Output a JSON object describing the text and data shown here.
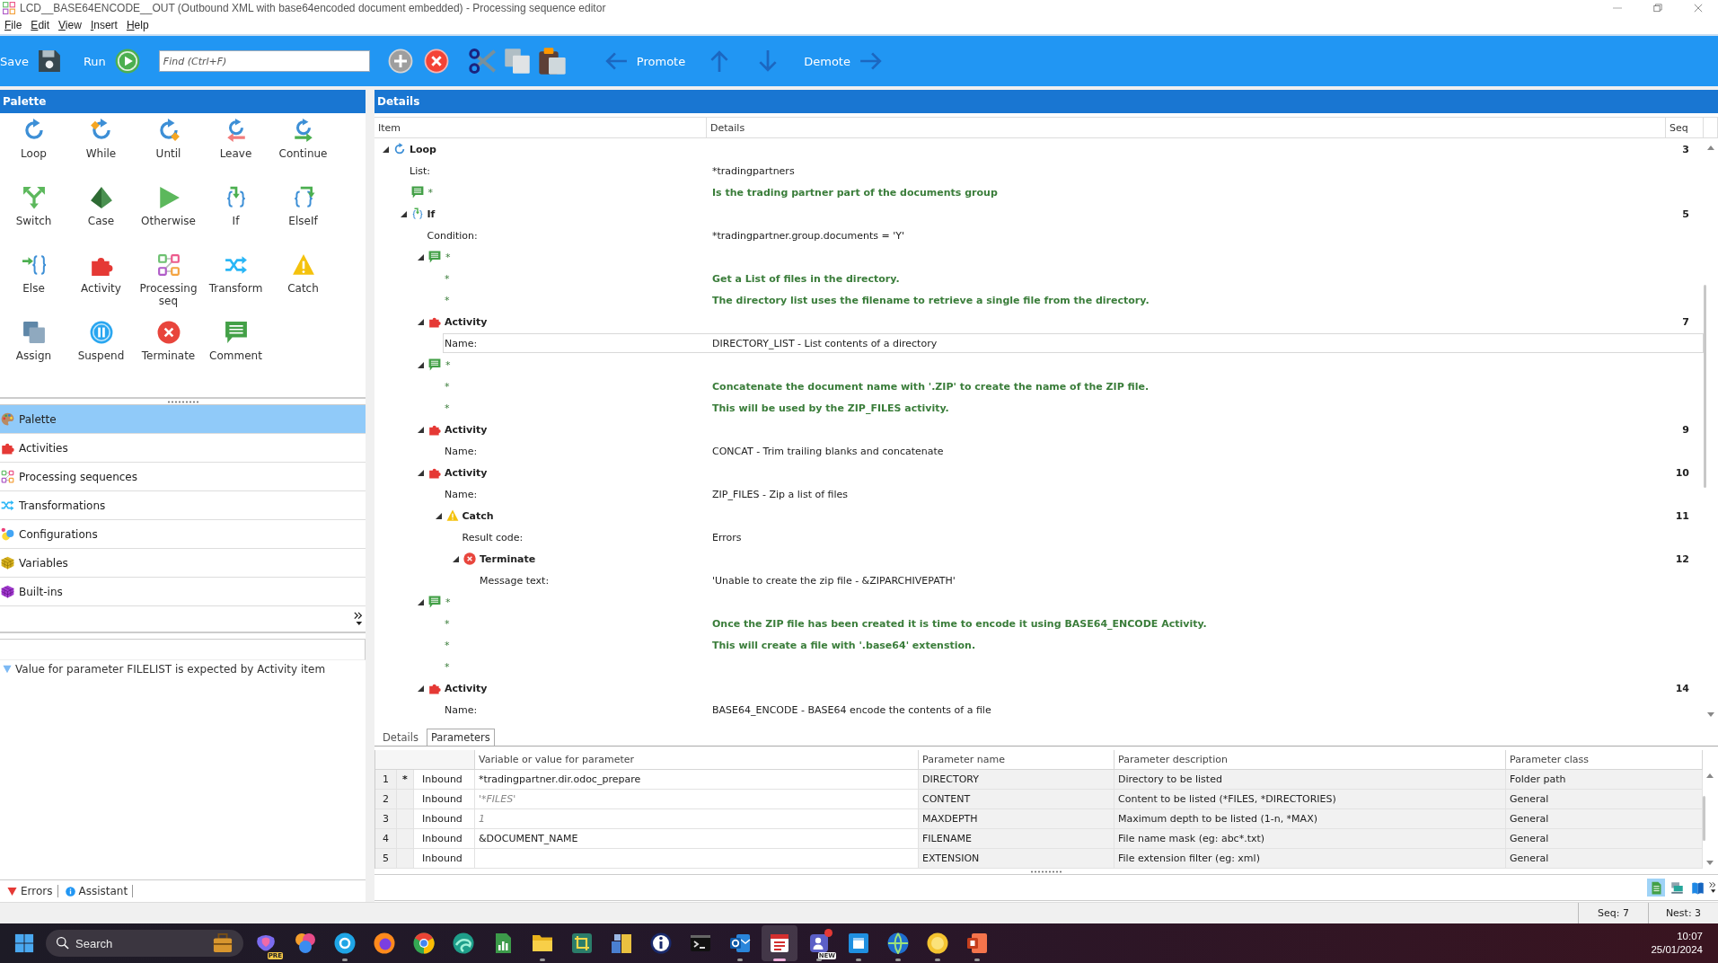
{
  "window": {
    "title": "LCD__BASE64ENCODE__OUT (Outbound XML with base64encoded document embedded) - Processing sequence editor"
  },
  "menu": [
    "File",
    "Edit",
    "View",
    "Insert",
    "Help"
  ],
  "toolbar": {
    "save": "Save",
    "run": "Run",
    "find": {
      "placeholder": "Find (Ctrl+F)"
    },
    "promote": "Promote",
    "demote": "Demote"
  },
  "palette": {
    "title": "Palette",
    "items": [
      {
        "label": "Loop",
        "kind": "loop"
      },
      {
        "label": "While",
        "kind": "while"
      },
      {
        "label": "Until",
        "kind": "until"
      },
      {
        "label": "Leave",
        "kind": "leave"
      },
      {
        "label": "Continue",
        "kind": "continue"
      },
      {
        "label": "Switch",
        "kind": "switch"
      },
      {
        "label": "Case",
        "kind": "case"
      },
      {
        "label": "Otherwise",
        "kind": "otherwise"
      },
      {
        "label": "If",
        "kind": "if"
      },
      {
        "label": "ElseIf",
        "kind": "elseif"
      },
      {
        "label": "Else",
        "kind": "else"
      },
      {
        "label": "Activity",
        "kind": "activity"
      },
      {
        "label": "Processing seq",
        "kind": "sequence"
      },
      {
        "label": "Transform",
        "kind": "transform"
      },
      {
        "label": "Catch",
        "kind": "catch"
      },
      {
        "label": "Assign",
        "kind": "assign"
      },
      {
        "label": "Suspend",
        "kind": "suspend"
      },
      {
        "label": "Terminate",
        "kind": "terminate"
      },
      {
        "label": "Comment",
        "kind": "comment"
      }
    ]
  },
  "navigator": {
    "items": [
      {
        "label": "Palette",
        "kind": "palette",
        "selected": true
      },
      {
        "label": "Activities",
        "kind": "activity",
        "selected": false
      },
      {
        "label": "Processing sequences",
        "kind": "sequence",
        "selected": false
      },
      {
        "label": "Transformations",
        "kind": "transform",
        "selected": false
      },
      {
        "label": "Configurations",
        "kind": "configuration",
        "selected": false
      },
      {
        "label": "Variables",
        "kind": "variable",
        "selected": false
      },
      {
        "label": "Built-ins",
        "kind": "builtin",
        "selected": false
      }
    ]
  },
  "messages": [
    {
      "text": "Value for parameter FILELIST is expected by Activity item"
    }
  ],
  "bottom_tabs": [
    {
      "label": "Errors",
      "kind": "errors"
    },
    {
      "label": "Assistant",
      "kind": "assistant"
    }
  ],
  "details": {
    "title": "Details",
    "columns": [
      "Item",
      "Details",
      "Seq"
    ],
    "tree": [
      {
        "kind": "loop",
        "title": "Loop",
        "seq": "3",
        "expanded": true,
        "fields": [
          {
            "label": "List:",
            "value": "*tradingpartners",
            "selected": false
          }
        ],
        "children": [
          {
            "kind": "comment",
            "marker": "*",
            "text": "Is the trading partner part of the documents group"
          },
          {
            "kind": "if",
            "title": "If",
            "seq": "5",
            "expanded": true,
            "fields": [
              {
                "label": "Condition:",
                "value": "*tradingpartner.group.documents = 'Y'",
                "selected": false
              }
            ],
            "children": [
              {
                "kind": "comment",
                "marker": "*",
                "expanded": true,
                "lines": [
                  {
                    "marker": "*",
                    "text": "Get a List of files in the directory."
                  },
                  {
                    "marker": "*",
                    "text": "The directory list uses the filename to retrieve a single file from the directory."
                  }
                ]
              },
              {
                "kind": "activity",
                "title": "Activity",
                "seq": "7",
                "expanded": true,
                "fields": [
                  {
                    "label": "Name:",
                    "value": "DIRECTORY_LIST - List contents of a directory",
                    "selected": true
                  }
                ]
              },
              {
                "kind": "comment",
                "marker": "*",
                "expanded": true,
                "lines": [
                  {
                    "marker": "*",
                    "text": "Concatenate the document name with '.ZIP' to create the name of the ZIP file."
                  },
                  {
                    "marker": "*",
                    "text": "This will be used by the ZIP_FILES activity."
                  }
                ]
              },
              {
                "kind": "activity",
                "title": "Activity",
                "seq": "9",
                "expanded": true,
                "fields": [
                  {
                    "label": "Name:",
                    "value": "CONCAT - Trim trailing blanks and concatenate",
                    "selected": false
                  }
                ]
              },
              {
                "kind": "activity",
                "title": "Activity",
                "seq": "10",
                "expanded": true,
                "fields": [
                  {
                    "label": "Name:",
                    "value": "ZIP_FILES - Zip a list of files",
                    "selected": false
                  }
                ],
                "children": [
                  {
                    "kind": "catch",
                    "title": "Catch",
                    "seq": "11",
                    "expanded": true,
                    "fields": [
                      {
                        "label": "Result code:",
                        "value": "Errors",
                        "selected": false
                      }
                    ],
                    "children": [
                      {
                        "kind": "terminate",
                        "title": "Terminate",
                        "seq": "12",
                        "expanded": true,
                        "fields": [
                          {
                            "label": "Message text:",
                            "value": "'Unable to create the zip file - &ZIPARCHIVEPATH'",
                            "selected": false
                          }
                        ]
                      }
                    ]
                  }
                ]
              },
              {
                "kind": "comment",
                "marker": "*",
                "expanded": true,
                "lines": [
                  {
                    "marker": "*",
                    "text": "Once the ZIP file has been created it is time to encode it using BASE64_ENCODE Activity."
                  },
                  {
                    "marker": "*",
                    "text": "This will create a file with '.base64' extenstion."
                  },
                  {
                    "marker": "*"
                  }
                ]
              },
              {
                "kind": "activity",
                "title": "Activity",
                "seq": "14",
                "expanded": true,
                "fields": [
                  {
                    "label": "Name:",
                    "value": "BASE64_ENCODE - BASE64 encode the contents of a file",
                    "selected": false
                  }
                ]
              }
            ]
          }
        ]
      }
    ]
  },
  "detail_tabs": [
    {
      "label": "Details",
      "selected": false
    },
    {
      "label": "Parameters",
      "selected": true
    }
  ],
  "parameters": {
    "columns": [
      "Variable or value for parameter",
      "Parameter name",
      "Parameter description",
      "Parameter class"
    ],
    "rows": [
      {
        "number": "1",
        "marker": "*",
        "direction": "Inbound",
        "value": "*tradingpartner.dir.odoc_prepare",
        "is_default": false,
        "name": "DIRECTORY",
        "description": "Directory to be listed",
        "class": "Folder path"
      },
      {
        "number": "2",
        "direction": "Inbound",
        "value": "'*FILES'",
        "is_default": true,
        "name": "CONTENT",
        "description": "Content to be listed (*FILES, *DIRECTORIES)",
        "class": "General"
      },
      {
        "number": "3",
        "direction": "Inbound",
        "value": "1",
        "is_default": true,
        "name": "MAXDEPTH",
        "description": "Maximum depth to be listed (1-n, *MAX)",
        "class": "General"
      },
      {
        "number": "4",
        "direction": "Inbound",
        "value": "&DOCUMENT_NAME",
        "is_default": false,
        "name": "FILENAME",
        "description": "File name mask (eg: abc*.txt)",
        "class": "General"
      },
      {
        "number": "5",
        "direction": "Inbound",
        "name": "EXTENSION",
        "description": "File extension filter (eg: xml)",
        "class": "General"
      }
    ]
  },
  "detail_tools": [
    {
      "kind": "document",
      "selected": true
    },
    {
      "kind": "tray",
      "selected": false
    },
    {
      "kind": "book",
      "selected": false
    }
  ],
  "status_bar": {
    "seq": "Seq: 7",
    "nest": "Nest: 3"
  },
  "taskbar": {
    "search": {
      "placeholder": "Search"
    },
    "apps": [
      {
        "kind": "ribbon",
        "badge": "PRE",
        "running": false,
        "selected": false
      },
      {
        "kind": "petals",
        "running": false,
        "selected": false
      },
      {
        "kind": "disc",
        "running": true,
        "selected": false
      },
      {
        "kind": "orb",
        "running": false,
        "selected": false
      },
      {
        "kind": "wheel",
        "running": false,
        "selected": false
      },
      {
        "kind": "wave",
        "running": false,
        "selected": false
      },
      {
        "kind": "chart",
        "running": false,
        "selected": false
      },
      {
        "kind": "folder",
        "running": true,
        "selected": false
      },
      {
        "kind": "crop",
        "running": false,
        "selected": false
      },
      {
        "kind": "blocks",
        "running": false,
        "selected": false
      },
      {
        "kind": "info",
        "running": false,
        "selected": false
      },
      {
        "kind": "terminal",
        "running": false,
        "selected": false
      },
      {
        "kind": "mail",
        "running": true,
        "selected": false
      },
      {
        "kind": "board",
        "running": true,
        "selected": true
      },
      {
        "kind": "people",
        "badge": "NEW",
        "alert": true,
        "running": true,
        "selected": false
      },
      {
        "kind": "window",
        "running": true,
        "selected": false
      },
      {
        "kind": "globe",
        "running": true,
        "selected": false
      },
      {
        "kind": "medal",
        "running": true,
        "selected": false
      },
      {
        "kind": "slides",
        "running": true,
        "selected": false
      }
    ],
    "time": "10:07",
    "date": "25/01/2024"
  }
}
